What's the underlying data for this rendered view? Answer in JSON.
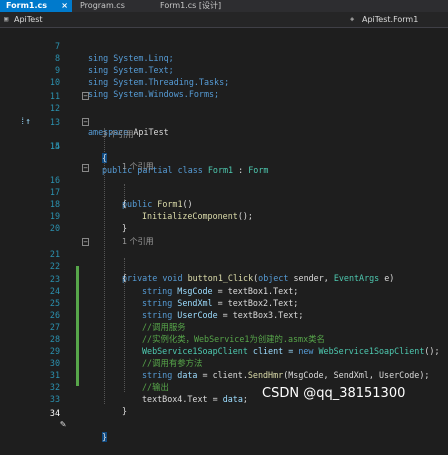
{
  "tabs": [
    {
      "label": "Form1.cs",
      "active": true
    },
    {
      "label": "Program.cs",
      "active": false
    },
    {
      "label": "Form1.cs [设计]",
      "active": false
    }
  ],
  "tab_close": "×",
  "nav": {
    "project": "ApiTest",
    "class": "ApiTest.Form1"
  },
  "ref_text": "1 个引用",
  "ref_text_3": "3 个引用",
  "lines": {
    "l7": "sing System.Linq;",
    "l8": "sing System.Text;",
    "l9": "sing System.Threading.Tasks;",
    "l10": "sing System.Windows.Forms;",
    "l12a": "amespace",
    "l12b": " ApiTest",
    "l14a": "public partial class ",
    "l14b": "Form1",
    "l14c": " : ",
    "l14d": "Form",
    "l16a": "public ",
    "l16b": "Form1",
    "l16c": "()",
    "l18a": "InitializeComponent",
    "l18b": "();",
    "l21a": "private void ",
    "l21b": "button1_Click",
    "l21c": "(",
    "l21d": "object",
    "l21e": " sender, ",
    "l21f": "EventArgs",
    "l21g": " e)",
    "l23a": "string ",
    "l23b": "MsgCode",
    "l23c": " = textBox1.Text;",
    "l24a": "string ",
    "l24b": "SendXml",
    "l24c": " = textBox2.Text;",
    "l25a": "string ",
    "l25b": "UserCode",
    "l25c": " = textBox3.Text;",
    "l26": "//调用服务",
    "l27": "//实例化类，WebService1为创建的.asmx类名",
    "l28a": "WebService1SoapClient",
    "l28b": " client = ",
    "l28c": "new ",
    "l28d": "WebService1SoapClient",
    "l28e": "();",
    "l29": "//调用有参方法",
    "l30a": "string ",
    "l30b": "data",
    "l30c": " = client.",
    "l30d": "SendHmr",
    "l30e": "(MsgCode, SendXml, UserCode);",
    "l31": "//输出",
    "l32a": "textBox4.Text = ",
    "l32b": "data",
    "l32c": ";"
  },
  "line_numbers": [
    "7",
    "8",
    "9",
    "10",
    "11",
    "12",
    "13",
    "14",
    "15",
    "16",
    "17",
    "18",
    "19",
    "20",
    "21",
    "22",
    "23",
    "24",
    "25",
    "26",
    "27",
    "28",
    "29",
    "30",
    "31",
    "32",
    "33",
    "34"
  ],
  "watermark": "CSDN @qq_38151300"
}
